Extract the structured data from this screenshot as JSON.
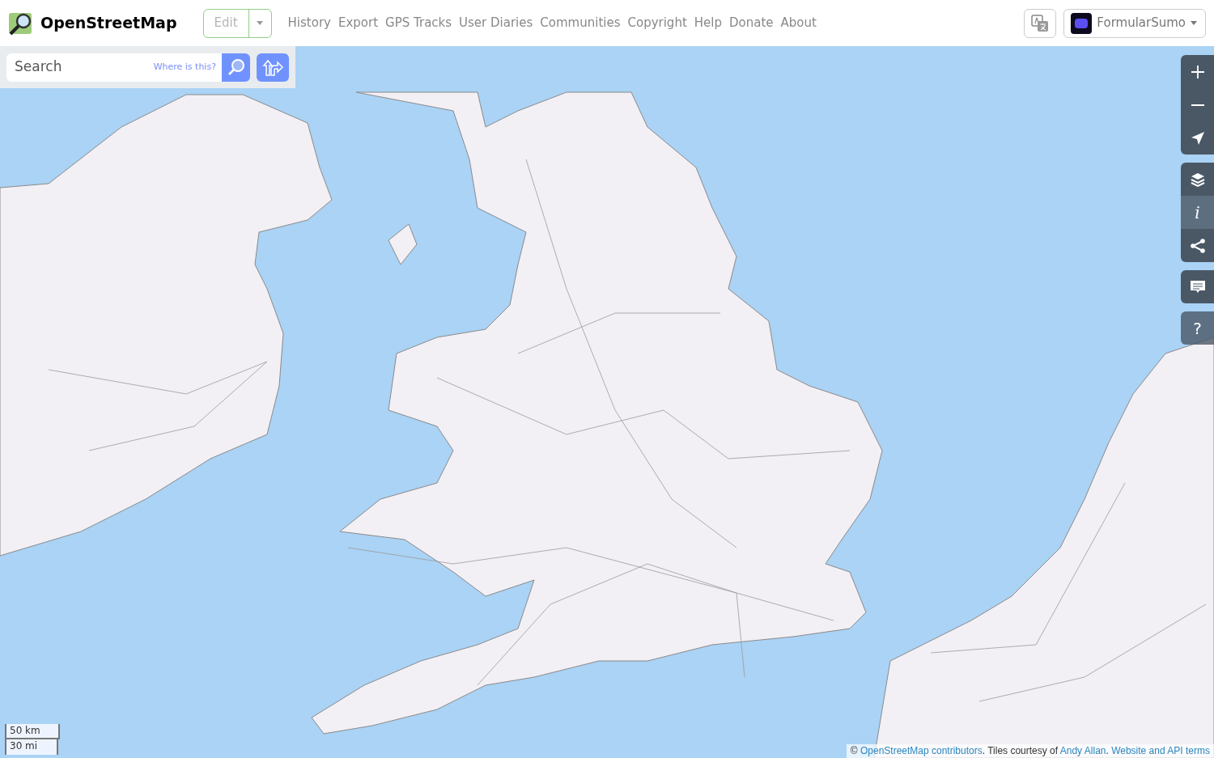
{
  "header": {
    "brand": "OpenStreetMap",
    "edit": {
      "label": "Edit",
      "disabled": true
    },
    "nav": [
      "History",
      "Export",
      "GPS Tracks",
      "User Diaries",
      "Communities",
      "Copyright",
      "Help",
      "Donate",
      "About"
    ],
    "user": {
      "name": "FormularSumo"
    }
  },
  "search": {
    "placeholder": "Search",
    "where_link": "Where is this?"
  },
  "map_controls": [
    [
      {
        "kind": "zoom-in"
      },
      {
        "kind": "zoom-out"
      },
      {
        "kind": "locate"
      }
    ],
    [
      {
        "kind": "layers",
        "selected": false
      },
      {
        "kind": "info",
        "text": "i",
        "selected": true
      },
      {
        "kind": "share",
        "selected": false
      }
    ],
    [
      {
        "kind": "note"
      }
    ],
    [
      {
        "kind": "help",
        "text": "?"
      }
    ]
  ],
  "scale": [
    "50 km",
    "30 mi"
  ],
  "attribution": [
    {
      "kind": "text",
      "text": "© "
    },
    {
      "kind": "link",
      "text": "OpenStreetMap contributors"
    },
    {
      "kind": "text",
      "text": ". Tiles courtesy of "
    },
    {
      "kind": "link",
      "text": "Andy Allan"
    },
    {
      "kind": "text",
      "text": ". "
    },
    {
      "kind": "link",
      "text": "Website and API terms"
    }
  ]
}
